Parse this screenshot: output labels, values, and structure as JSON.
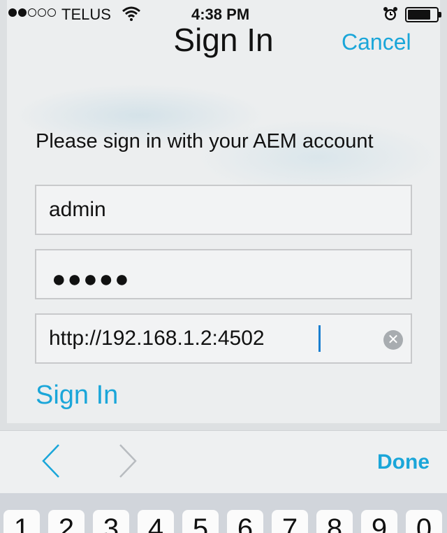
{
  "status_bar": {
    "signal_full": 2,
    "signal_total": 5,
    "carrier": "TELUS",
    "time": "4:38 PM",
    "battery_level": 0.75
  },
  "nav": {
    "title": "Sign In",
    "cancel_label": "Cancel"
  },
  "form": {
    "prompt": "Please sign in with your AEM account",
    "username_value": "admin",
    "password_masked": "●●●●●",
    "server_value": "http://192.168.1.2:4502",
    "signin_label": "Sign In"
  },
  "accessory_bar": {
    "done_label": "Done"
  },
  "keyboard": {
    "keys": [
      "1",
      "2",
      "3",
      "4",
      "5",
      "6",
      "7",
      "8",
      "9",
      "0"
    ]
  },
  "colors": {
    "accent": "#1aa6d9",
    "background": "#eceeef"
  }
}
